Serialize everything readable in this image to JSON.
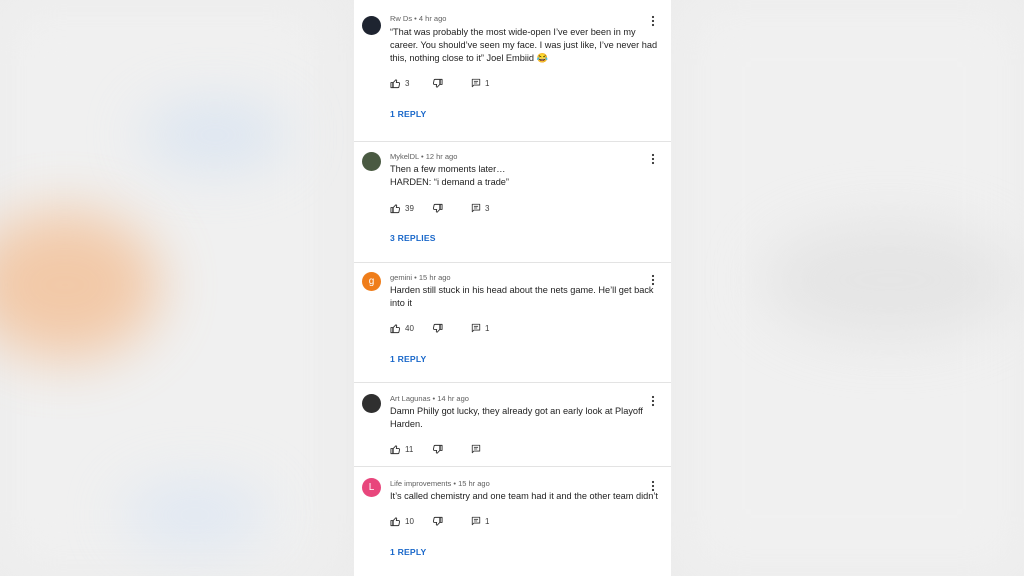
{
  "comments": [
    {
      "author": "Rw Ds",
      "time": "4 hr ago",
      "text": "“That was probably the most wide-open I’ve ever been in my career. You should’ve seen my face. I was just like, I’ve never had this, nothing close to it” Joel Embiid 😂",
      "likes": "3",
      "reply_count": "1",
      "replies_link": "1 REPLY",
      "avatar_color": "#1e2430",
      "avatar_letter": ""
    },
    {
      "author": "MykelDL",
      "time": "12 hr ago",
      "text": "Then a few moments later…\nHARDEN: “i demand a trade”",
      "likes": "39",
      "reply_count": "3",
      "replies_link": "3 REPLIES",
      "avatar_color": "#4a5a42",
      "avatar_letter": ""
    },
    {
      "author": "gemini",
      "time": "15 hr ago",
      "text": "Harden still stuck in his head about the nets game. He’ll get back into it",
      "likes": "40",
      "reply_count": "1",
      "replies_link": "1 REPLY",
      "avatar_color": "#ef7d1a",
      "avatar_letter": "g"
    },
    {
      "author": "Art Lagunas",
      "time": "14 hr ago",
      "text": "Damn Philly got lucky, they already got an early look at Playoff Harden.",
      "likes": "11",
      "reply_count": "",
      "replies_link": "",
      "avatar_color": "#2f2f2f",
      "avatar_letter": ""
    },
    {
      "author": "Life improvements",
      "time": "15 hr ago",
      "text": "It’s called chemistry and one team had it and the other team didn’t",
      "likes": "10",
      "reply_count": "1",
      "replies_link": "1 REPLY",
      "avatar_color": "#e8467c",
      "avatar_letter": "L"
    }
  ],
  "icons": {
    "like": "thumb-up-icon",
    "dislike": "thumb-down-icon",
    "reply": "comment-icon",
    "menu": "more-vert-icon"
  },
  "colors": {
    "link": "#1967c9",
    "meta": "#606060"
  }
}
